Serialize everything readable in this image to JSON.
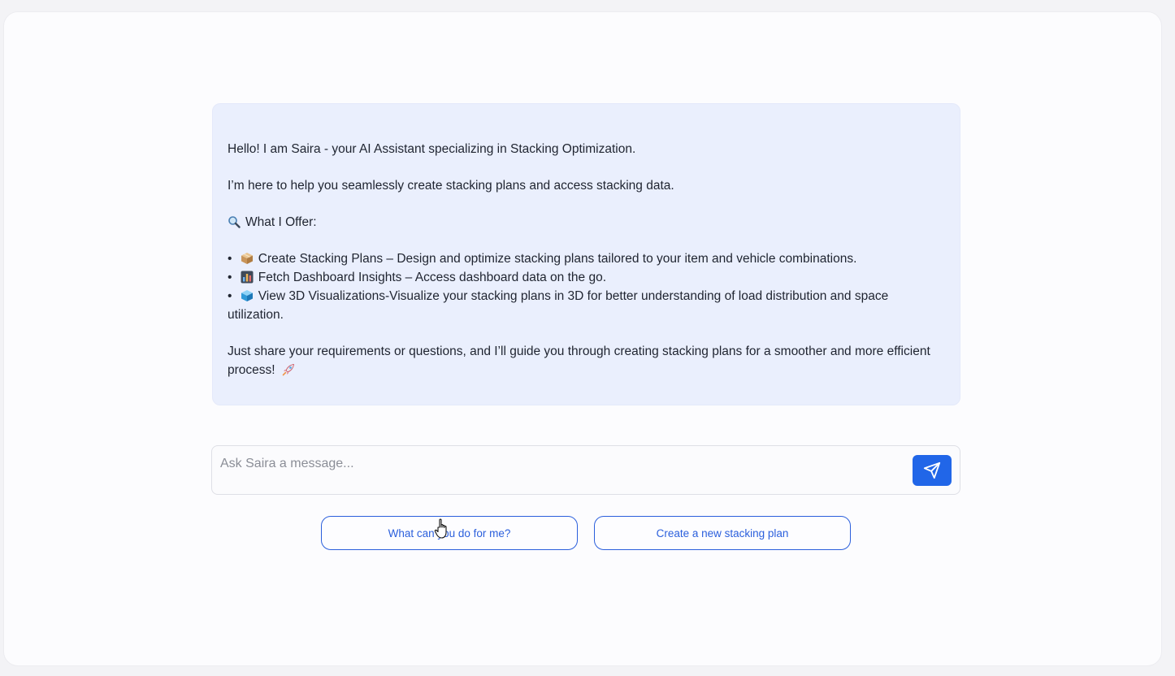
{
  "assistant": {
    "greeting": "Hello! I am Saira - your AI Assistant specializing in Stacking Optimization.",
    "intro": "I’m here to help you seamlessly create stacking plans and access stacking data.",
    "offer_heading": "What I Offer:",
    "offer_icon": "magnifier-icon",
    "offers": [
      {
        "bullet": "•",
        "icon": "package-icon",
        "text": "Create Stacking Plans – Design and optimize stacking plans tailored to your item and vehicle combinations."
      },
      {
        "bullet": "•",
        "icon": "bar-chart-icon",
        "text": "Fetch Dashboard Insights – Access dashboard data on the go."
      },
      {
        "bullet": "•",
        "icon": "cube-icon",
        "text": "View 3D Visualizations-Visualize your stacking plans in 3D for better understanding of load distribution and space utilization."
      }
    ],
    "closing": "Just share your requirements or questions, and I’ll guide you through creating stacking plans for a smoother and more efficient process!",
    "closing_icon": "rocket-icon"
  },
  "chat_input": {
    "placeholder": "Ask Saira a message...",
    "value": ""
  },
  "suggestions": [
    {
      "label": "What can you do for me?"
    },
    {
      "label": "Create a new stacking plan"
    }
  ],
  "colors": {
    "accent": "#2166e8",
    "card_background": "#eaeffd",
    "suggestion_border": "#2b5fdc"
  }
}
